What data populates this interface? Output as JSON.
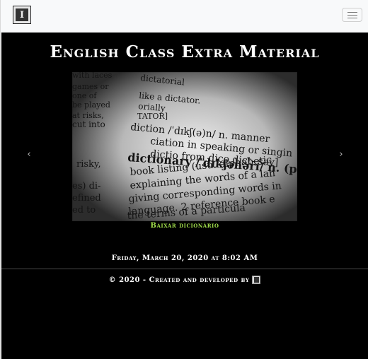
{
  "navbar": {
    "brand_icon": "book-logo-icon",
    "toggler_icon": "hamburger-menu-icon"
  },
  "main": {
    "title": "English Class Extra Material",
    "carousel": {
      "prev_icon": "chevron-left-icon",
      "next_icon": "chevron-right-icon",
      "prev_glyph": "‹",
      "next_glyph": "›",
      "slide_caption": "Baixar dicionário",
      "slide_image_text": [
        "with laces",
        "dictatorial",
        "games or",
        "like a dictator.",
        "one of",
        "orially",
        "be played",
        "at risks,",
        "TATOR]",
        "cut into",
        "diction /ˈdɪkʃ(ə)n/ n. manner",
        "ciation in speaking or singin",
        "dictio from dico dict- say]",
        "dictionary /ˈdɪkʃənərɪ/ n. (pl",
        "risky,",
        "book listing (usu. alphabetic",
        "explaining the words of a lan",
        "es) di-",
        "giving corresponding words in",
        "efined",
        "language. 2 reference book e",
        "ed to",
        "the terms of a particula"
      ]
    },
    "date": "Friday, March 20, 2020 at 8:02 AM",
    "footer_text": "© 2020 - Created and developed by",
    "footer_logo_icon": "book-logo-icon"
  },
  "colors": {
    "navbar_bg": "#f8f9fa",
    "page_bg": "#000000",
    "title_color": "#ffffff",
    "link_color": "#9fdc4a"
  }
}
